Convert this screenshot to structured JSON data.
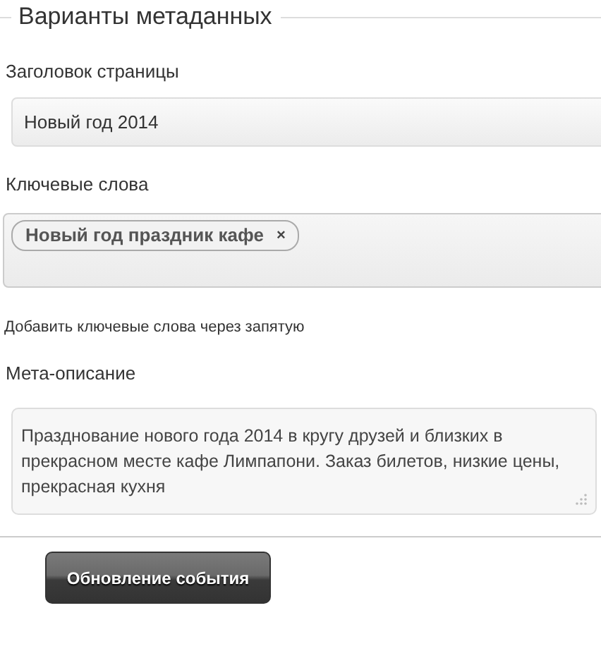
{
  "section": {
    "title": "Варианты метаданных"
  },
  "fields": [
    {
      "kind": "input",
      "label": "Заголовок страницы",
      "value": "Новый год 2014"
    },
    {
      "kind": "tags",
      "label": "Ключевые слова",
      "tags": [
        {
          "text": "Новый год праздник кафе",
          "remove": "×"
        }
      ],
      "hint": "Добавить ключевые слова через запятую"
    },
    {
      "kind": "textarea",
      "label": "Мета-описание",
      "value": "Празднование нового года 2014 в кругу друзей и близких в прекрасном месте кафе Лимпапони. Заказ билетов, низкие цены, прекрасная кухня"
    }
  ],
  "button": {
    "label": "Обновление события"
  }
}
